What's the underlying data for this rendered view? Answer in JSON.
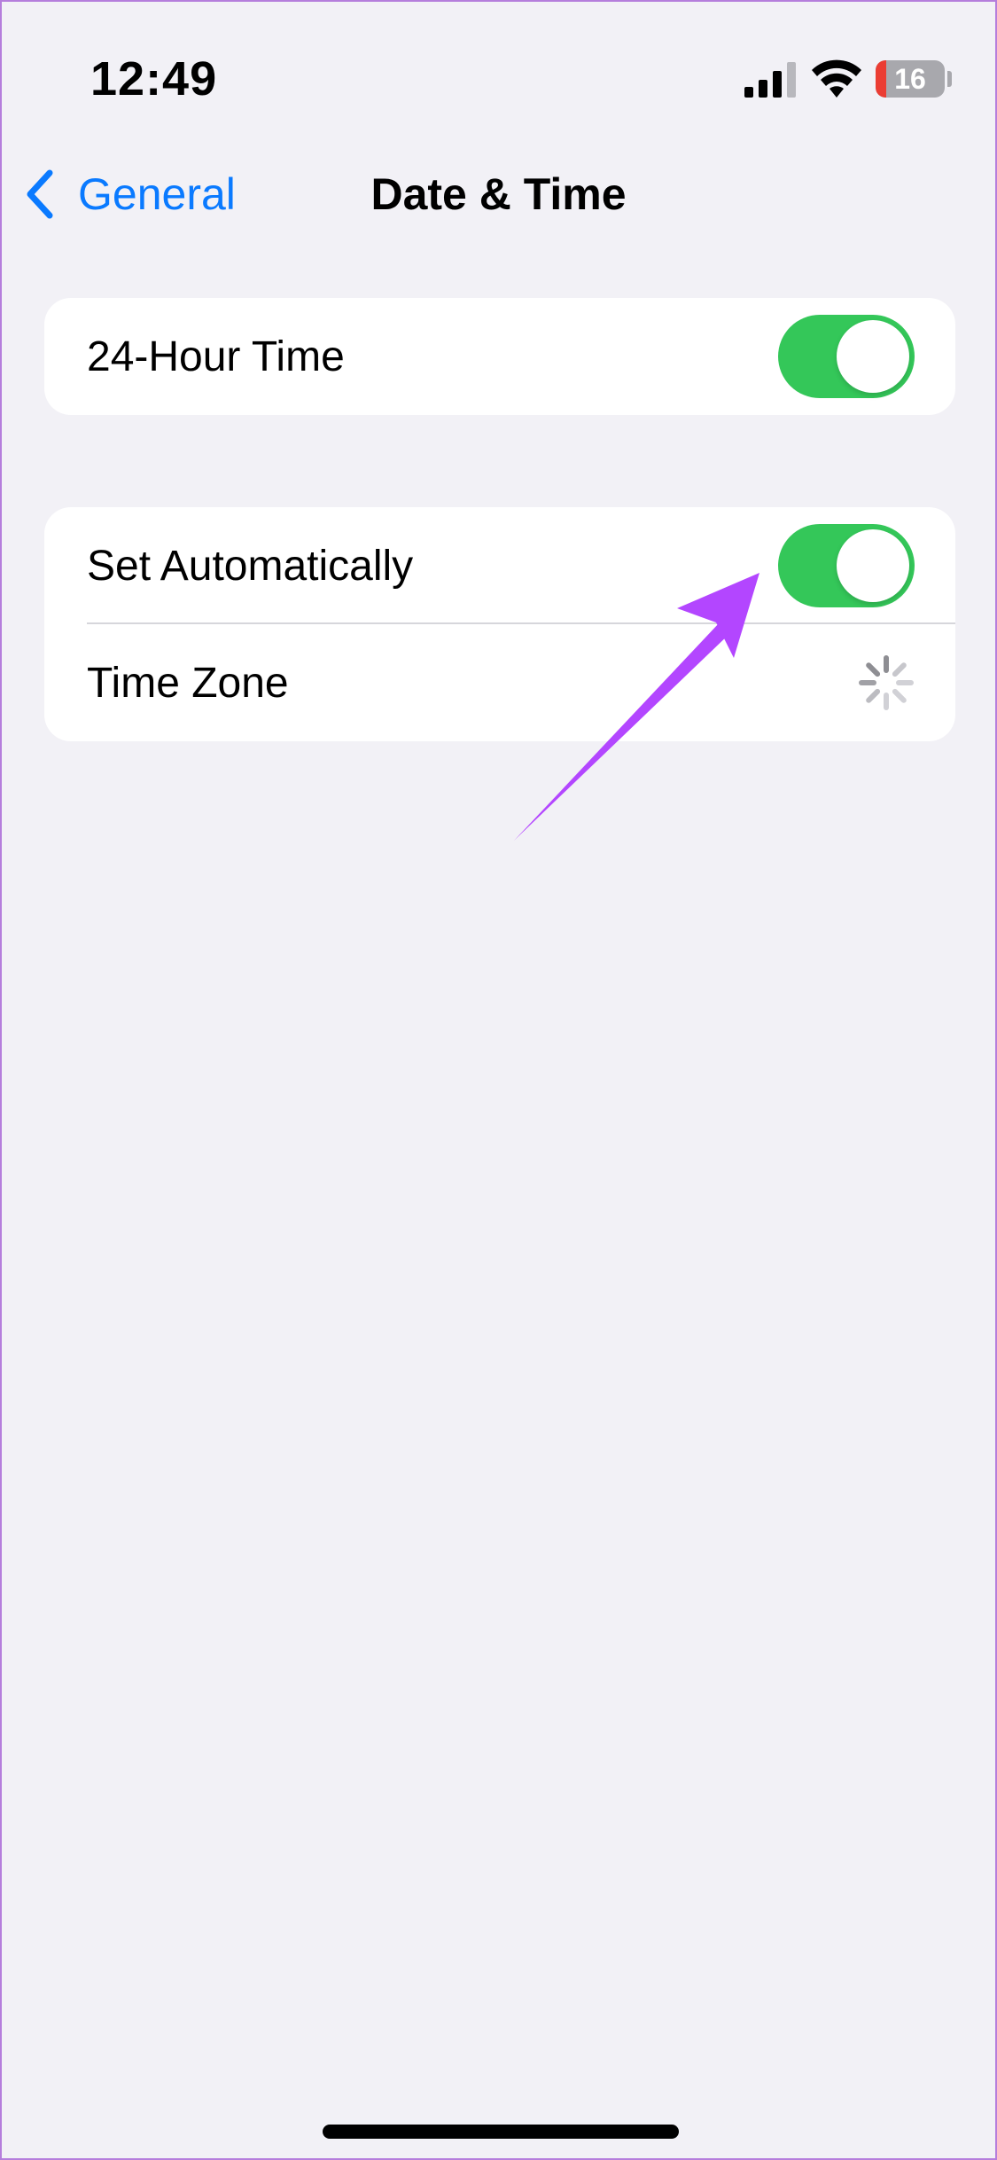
{
  "status_bar": {
    "time": "12:49",
    "battery_level": "16",
    "battery_fraction": 0.16
  },
  "nav": {
    "back_label": "General",
    "title": "Date & Time"
  },
  "groups": [
    {
      "rows": [
        {
          "label": "24-Hour Time",
          "control": "toggle",
          "on": true
        }
      ]
    },
    {
      "rows": [
        {
          "label": "Set Automatically",
          "control": "toggle",
          "on": true
        },
        {
          "label": "Time Zone",
          "control": "spinner"
        }
      ]
    }
  ],
  "colors": {
    "accent": "#0a7aff",
    "toggle_on": "#34c759",
    "annotation": "#b346ff",
    "background": "#f2f1f6"
  },
  "icons": {
    "back": "chevron-left-icon",
    "signal": "cellular-signal-icon",
    "wifi": "wifi-icon",
    "battery": "battery-icon",
    "loading": "activity-spinner-icon"
  }
}
